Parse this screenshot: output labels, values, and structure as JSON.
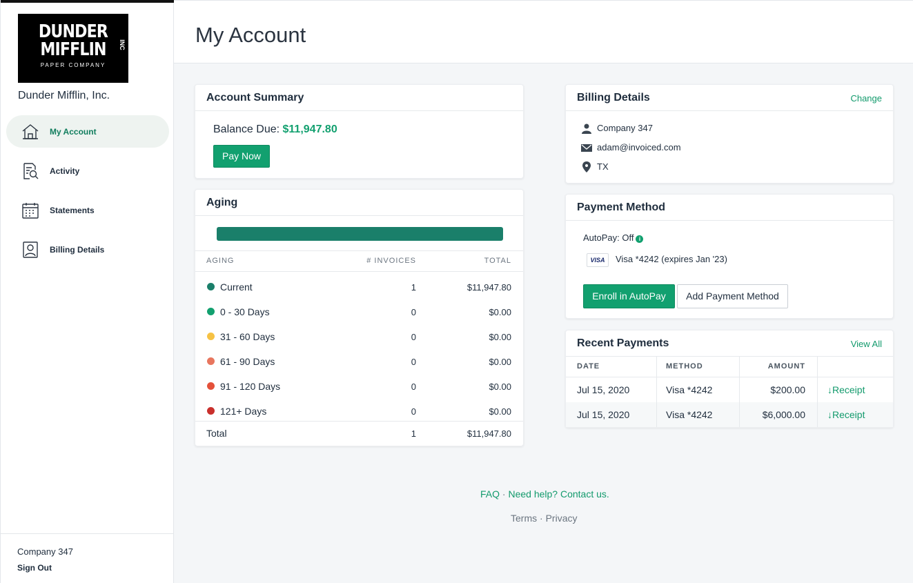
{
  "sidebar": {
    "logo": {
      "line1": "DUNDER",
      "line2": "MIFFLIN",
      "inc": "INC",
      "tagline": "PAPER COMPANY"
    },
    "company_name": "Dunder Mifflin, Inc.",
    "items": [
      {
        "label": "My Account",
        "icon": "home-icon",
        "active": true
      },
      {
        "label": "Activity",
        "icon": "document-search-icon",
        "active": false
      },
      {
        "label": "Statements",
        "icon": "calendar-icon",
        "active": false
      },
      {
        "label": "Billing Details",
        "icon": "user-card-icon",
        "active": false
      }
    ],
    "footer": {
      "customer": "Company 347",
      "sign_out": "Sign Out"
    }
  },
  "header": {
    "title": "My Account"
  },
  "account_summary": {
    "title": "Account Summary",
    "balance_label": "Balance Due: ",
    "balance_amount": "$11,947.80",
    "pay_now": "Pay Now"
  },
  "aging": {
    "title": "Aging",
    "current_fraction": 1.0,
    "columns": [
      "AGING",
      "# INVOICES",
      "TOTAL"
    ],
    "rows": [
      {
        "label": "Current",
        "count": "1",
        "total": "$11,947.80",
        "color": "#1a7f6a"
      },
      {
        "label": "0 - 30 Days",
        "count": "0",
        "total": "$0.00",
        "color": "#12a06f"
      },
      {
        "label": "31 - 60 Days",
        "count": "0",
        "total": "$0.00",
        "color": "#f6c244"
      },
      {
        "label": "61 - 90 Days",
        "count": "0",
        "total": "$0.00",
        "color": "#e8765e"
      },
      {
        "label": "91 - 120 Days",
        "count": "0",
        "total": "$0.00",
        "color": "#e4513a"
      },
      {
        "label": "121+ Days",
        "count": "0",
        "total": "$0.00",
        "color": "#c9302c"
      }
    ],
    "total": {
      "label": "Total",
      "count": "1",
      "total": "$11,947.80"
    }
  },
  "billing_details": {
    "title": "Billing Details",
    "action": "Change",
    "company": "Company 347",
    "email": "adam@invoiced.com",
    "location": "TX"
  },
  "payment_method": {
    "title": "Payment Method",
    "autopay": "AutoPay: Off",
    "card_brand": "VISA",
    "card_text": "Visa *4242 (expires Jan '23)",
    "enroll": "Enroll in AutoPay",
    "add": "Add Payment Method"
  },
  "recent_payments": {
    "title": "Recent Payments",
    "action": "View All",
    "columns": [
      "DATE",
      "METHOD",
      "AMOUNT"
    ],
    "rows": [
      {
        "date": "Jul 15, 2020",
        "method": "Visa *4242",
        "amount": "$200.00",
        "receipt": "↓Receipt"
      },
      {
        "date": "Jul 15, 2020",
        "method": "Visa *4242",
        "amount": "$6,000.00",
        "receipt": "↓Receipt"
      }
    ]
  },
  "footer": {
    "faq": "FAQ",
    "dot": "·",
    "help": "Need help? Contact us.",
    "terms": "Terms",
    "privacy": "Privacy"
  },
  "colors": {
    "accent": "#12a06f",
    "aging_bar": "#1a7f6a"
  }
}
